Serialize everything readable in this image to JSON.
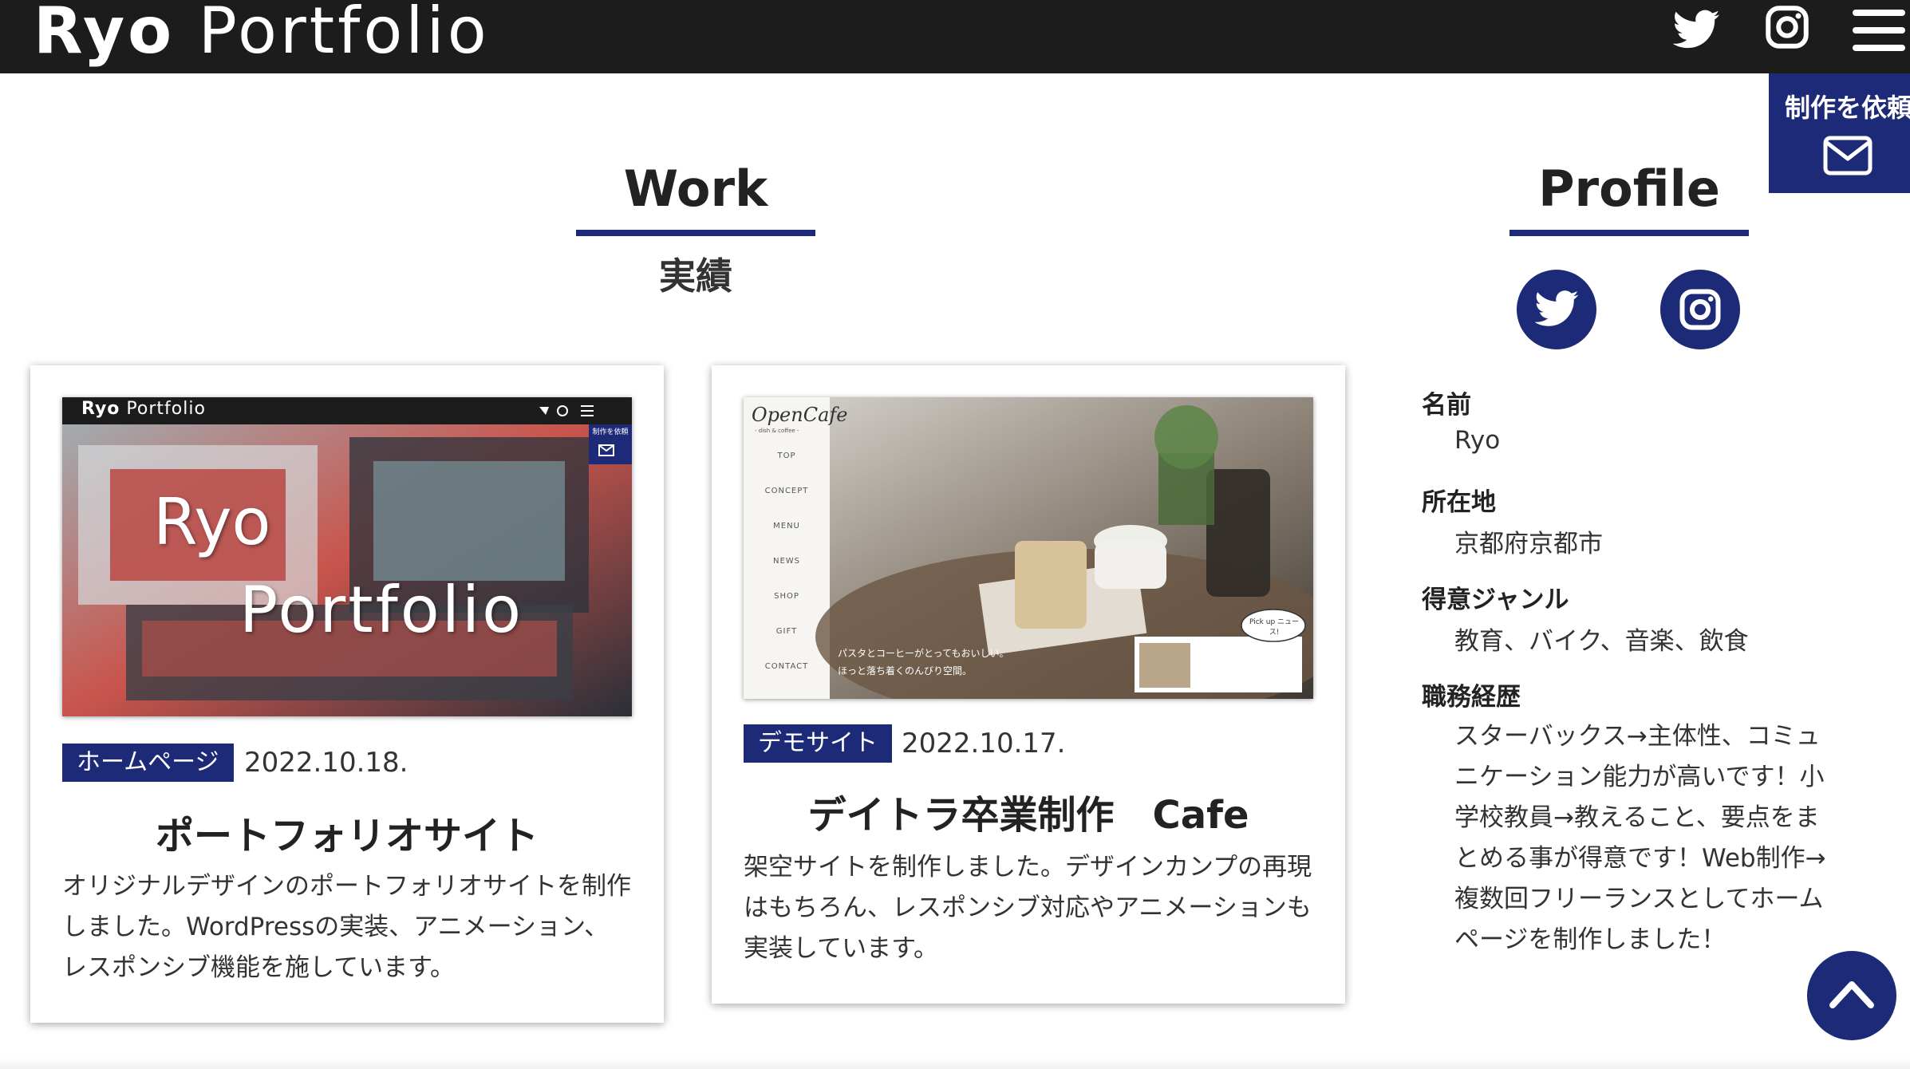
{
  "header": {
    "logo_bold": "Ryo",
    "logo_rest": "Portfolio",
    "icons": [
      "twitter-icon",
      "instagram-icon",
      "hamburger-menu-icon"
    ]
  },
  "request_tab": {
    "label": "制作を依頼",
    "icon": "mail-icon"
  },
  "work": {
    "title": "Work",
    "subtitle": "実績",
    "cards": [
      {
        "thumb_logo_bold": "Ryo",
        "thumb_logo_rest": "Portfolio",
        "thumb_request": "制作を依頼",
        "thumb_hero_1": "Ryo",
        "thumb_hero_2": "Portfolio",
        "badge": "ホームページ",
        "date": "2022.10.18.",
        "title": "ポートフォリオサイト",
        "description": "オリジナルデザインのポートフォリオサイトを制作しました。WordPressの実装、アニメーション、レスポンシブ機能を施しています。"
      },
      {
        "thumb_logo": "OpenCafe",
        "thumb_logo_sub": "- dish & coffee -",
        "thumb_menu": [
          "TOP",
          "CONCEPT",
          "MENU",
          "NEWS",
          "SHOP",
          "GIFT",
          "CONTACT"
        ],
        "thumb_caption_1": "パスタとコーヒーがとってもおいしい。",
        "thumb_caption_2": "ほっと落ち着くのんびり空間。",
        "thumb_bubble": "Pick up ニュース!",
        "badge": "デモサイト",
        "date": "2022.10.17.",
        "title": "デイトラ卒業制作　Cafe",
        "description": "架空サイトを制作しました。デザインカンプの再現はもちろん、レスポンシブ対応やアニメーションも実装しています。"
      }
    ]
  },
  "profile": {
    "title": "Profile",
    "icons": [
      "twitter-icon",
      "instagram-icon"
    ],
    "fields": [
      {
        "label": "名前",
        "value": "Ryo"
      },
      {
        "label": "所在地",
        "value": "京都府京都市"
      },
      {
        "label": "得意ジャンル",
        "value": "教育、バイク、音楽、飲食"
      },
      {
        "label": "職務経歴",
        "value": "スターバックス→主体性、コミュニケーション能力が高いです！小学校教員→教えること、要点をまとめる事が得意です！Web制作→複数回フリーランスとしてホームページを制作しました！"
      }
    ]
  },
  "colors": {
    "navy": "#1d2a78",
    "header": "#1c1c1c"
  },
  "back_to_top_icon": "chevron-up-icon"
}
